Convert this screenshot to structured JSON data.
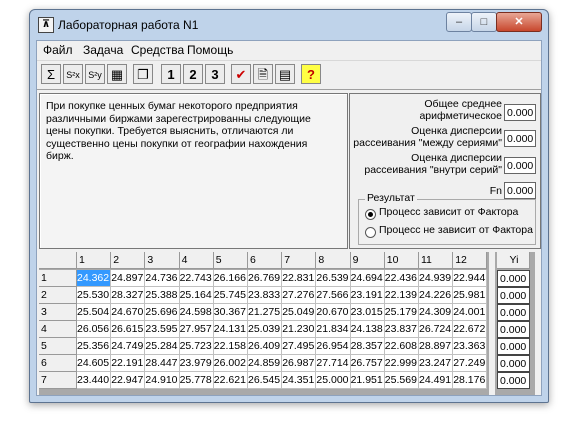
{
  "window": {
    "title": "Лабораторная работа N1",
    "app_icon": "chart-app-icon"
  },
  "caption_buttons": {
    "minimize": "–",
    "maximize": "□",
    "close": "✕"
  },
  "menu": {
    "items": [
      "Файл",
      "Задача",
      "Средства",
      "Помощь"
    ]
  },
  "toolbar": {
    "buttons": [
      {
        "name": "sum-icon",
        "label": "Σ"
      },
      {
        "name": "variance-sx-icon",
        "label": "S²x"
      },
      {
        "name": "variance-sy-icon",
        "label": "S²y"
      },
      {
        "name": "calculator-icon",
        "label": "▦"
      },
      {
        "name": "copy-icon",
        "label": "❐"
      },
      {
        "name": "task-1-button",
        "label": "1"
      },
      {
        "name": "task-2-button",
        "label": "2"
      },
      {
        "name": "task-3-button",
        "label": "3"
      },
      {
        "name": "check-icon",
        "label": "✔"
      },
      {
        "name": "document-icon",
        "label": "🗎"
      },
      {
        "name": "table-icon",
        "label": "▤"
      },
      {
        "name": "help-icon",
        "label": "?"
      }
    ]
  },
  "task": {
    "text": "При покупке ценных бумаг некоторого предприятия различными биржами зарегестрированны следующие цены покупки. Требуется выяснить, отличаются ли существенно цены покупки от географии нахождения бирж."
  },
  "results": {
    "mean_label": "Общее среднее арифметическое",
    "mean_value": "0.000",
    "between_label": "Оценка дисперсии рассеивания \"между сериями\"",
    "between_value": "0.000",
    "within_label": "Оценка дисперсии рассеивания \"внутри серий\"",
    "within_value": "0.000",
    "fn_label": "Fn",
    "fn_value": "0.000"
  },
  "result_group": {
    "title": "Результат",
    "options": [
      "Процесс зависит от Фактора",
      "Процесс не зависит от Фактора"
    ],
    "selected": 0
  },
  "table": {
    "columns": [
      "1",
      "2",
      "3",
      "4",
      "5",
      "6",
      "7",
      "8",
      "9",
      "10",
      "11",
      "12"
    ],
    "rows": [
      {
        "label": "1",
        "values": [
          "24.362",
          "24.897",
          "24.736",
          "22.743",
          "26.166",
          "26.769",
          "22.831",
          "26.539",
          "24.694",
          "22.436",
          "24.939",
          "22.944"
        ]
      },
      {
        "label": "2",
        "values": [
          "25.530",
          "28.327",
          "25.388",
          "25.164",
          "25.745",
          "23.833",
          "27.276",
          "27.566",
          "23.191",
          "22.139",
          "24.226",
          "25.981"
        ]
      },
      {
        "label": "3",
        "values": [
          "25.504",
          "24.670",
          "25.696",
          "24.598",
          "30.367",
          "21.275",
          "25.049",
          "20.670",
          "23.015",
          "25.179",
          "24.309",
          "24.001"
        ]
      },
      {
        "label": "4",
        "values": [
          "26.056",
          "26.615",
          "23.595",
          "27.957",
          "24.131",
          "25.039",
          "21.230",
          "21.834",
          "24.138",
          "23.837",
          "26.724",
          "22.672"
        ]
      },
      {
        "label": "5",
        "values": [
          "25.356",
          "24.749",
          "25.284",
          "25.723",
          "22.158",
          "26.409",
          "27.495",
          "26.954",
          "28.357",
          "22.608",
          "28.897",
          "23.363"
        ]
      },
      {
        "label": "6",
        "values": [
          "24.605",
          "22.191",
          "28.447",
          "23.979",
          "26.002",
          "24.859",
          "26.987",
          "27.714",
          "26.757",
          "22.999",
          "23.247",
          "27.249"
        ]
      },
      {
        "label": "7",
        "values": [
          "23.440",
          "22.947",
          "24.910",
          "25.778",
          "22.621",
          "26.545",
          "24.351",
          "25.000",
          "21.951",
          "25.569",
          "24.491",
          "28.176"
        ]
      }
    ],
    "selected_cell": "24.362"
  },
  "yi": {
    "header": "Yi",
    "values": [
      "0.000",
      "0.000",
      "0.000",
      "0.000",
      "0.000",
      "0.000",
      "0.000"
    ]
  }
}
